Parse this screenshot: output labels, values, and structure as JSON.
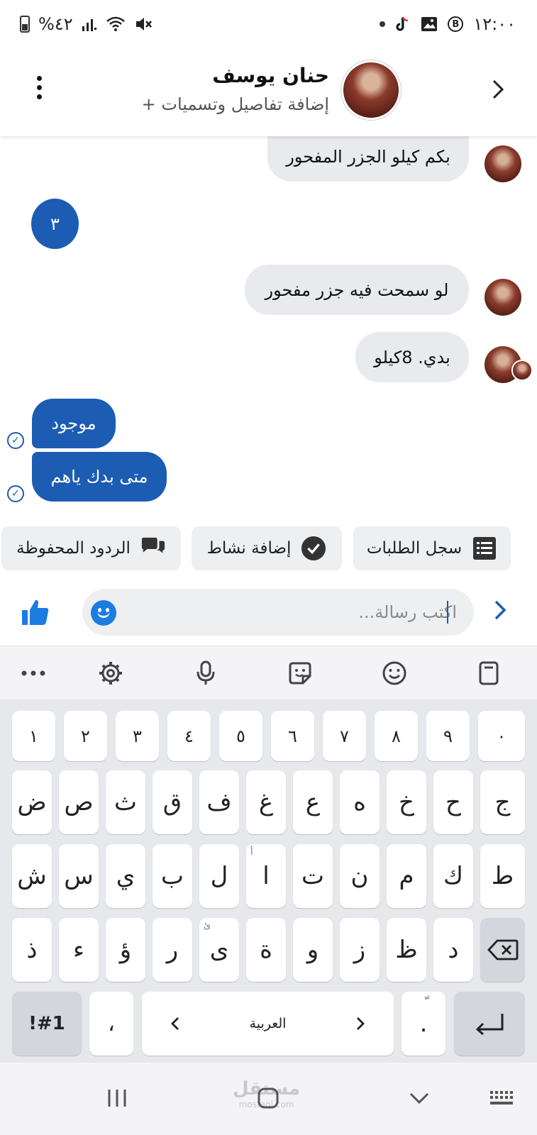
{
  "status_bar": {
    "time": "١٢:٠٠",
    "battery_text": "%٤٢"
  },
  "header": {
    "contact_name": "حنان يوسف",
    "subtitle": "+ إضافة تفاصيل وتسميات"
  },
  "messages": {
    "in_1": "بكم كيلو الجزر المفحور",
    "number_bubble": "٣",
    "in_2": "لو سمحت فيه جزر مفحور",
    "in_3": "بدي. 8كيلو",
    "out_1": "موجود",
    "out_2": "متى بدك ياهم"
  },
  "quick_actions": {
    "orders_log": "سجل الطلبات",
    "add_activity": "إضافة نشاط",
    "saved_replies": "الردود المحفوظة"
  },
  "composer": {
    "placeholder": "اكتب رسالة..."
  },
  "keyboard": {
    "number_row": [
      "١",
      "٢",
      "٣",
      "٤",
      "٥",
      "٦",
      "٧",
      "٨",
      "٩",
      "٠"
    ],
    "row1": [
      "ض",
      "ص",
      "ث",
      "ق",
      "ف",
      "غ",
      "ع",
      "ه",
      "خ",
      "ح",
      "ج"
    ],
    "row2": [
      "ش",
      "س",
      "ي",
      "ب",
      "ل",
      "ا",
      "ت",
      "ن",
      "م",
      "ك",
      "ط"
    ],
    "row2_hint_alef": "أ",
    "row3": [
      "ذ",
      "ء",
      "ؤ",
      "ر",
      "ى",
      "ة",
      "و",
      "ز",
      "ظ",
      "د"
    ],
    "row3_hint_ya": "ئ",
    "symbols_key": "!#1",
    "comma_key": "،",
    "language_label": "العربية",
    "period_key": ".",
    "period_hint": "ّ"
  },
  "nav": {
    "watermark": "مستقل",
    "watermark_sub": "mostaql.com"
  },
  "colors": {
    "accent": "#1c5cb3",
    "incoming_bubble": "#e9eaee",
    "keyboard_bg": "#e7e8ec"
  }
}
